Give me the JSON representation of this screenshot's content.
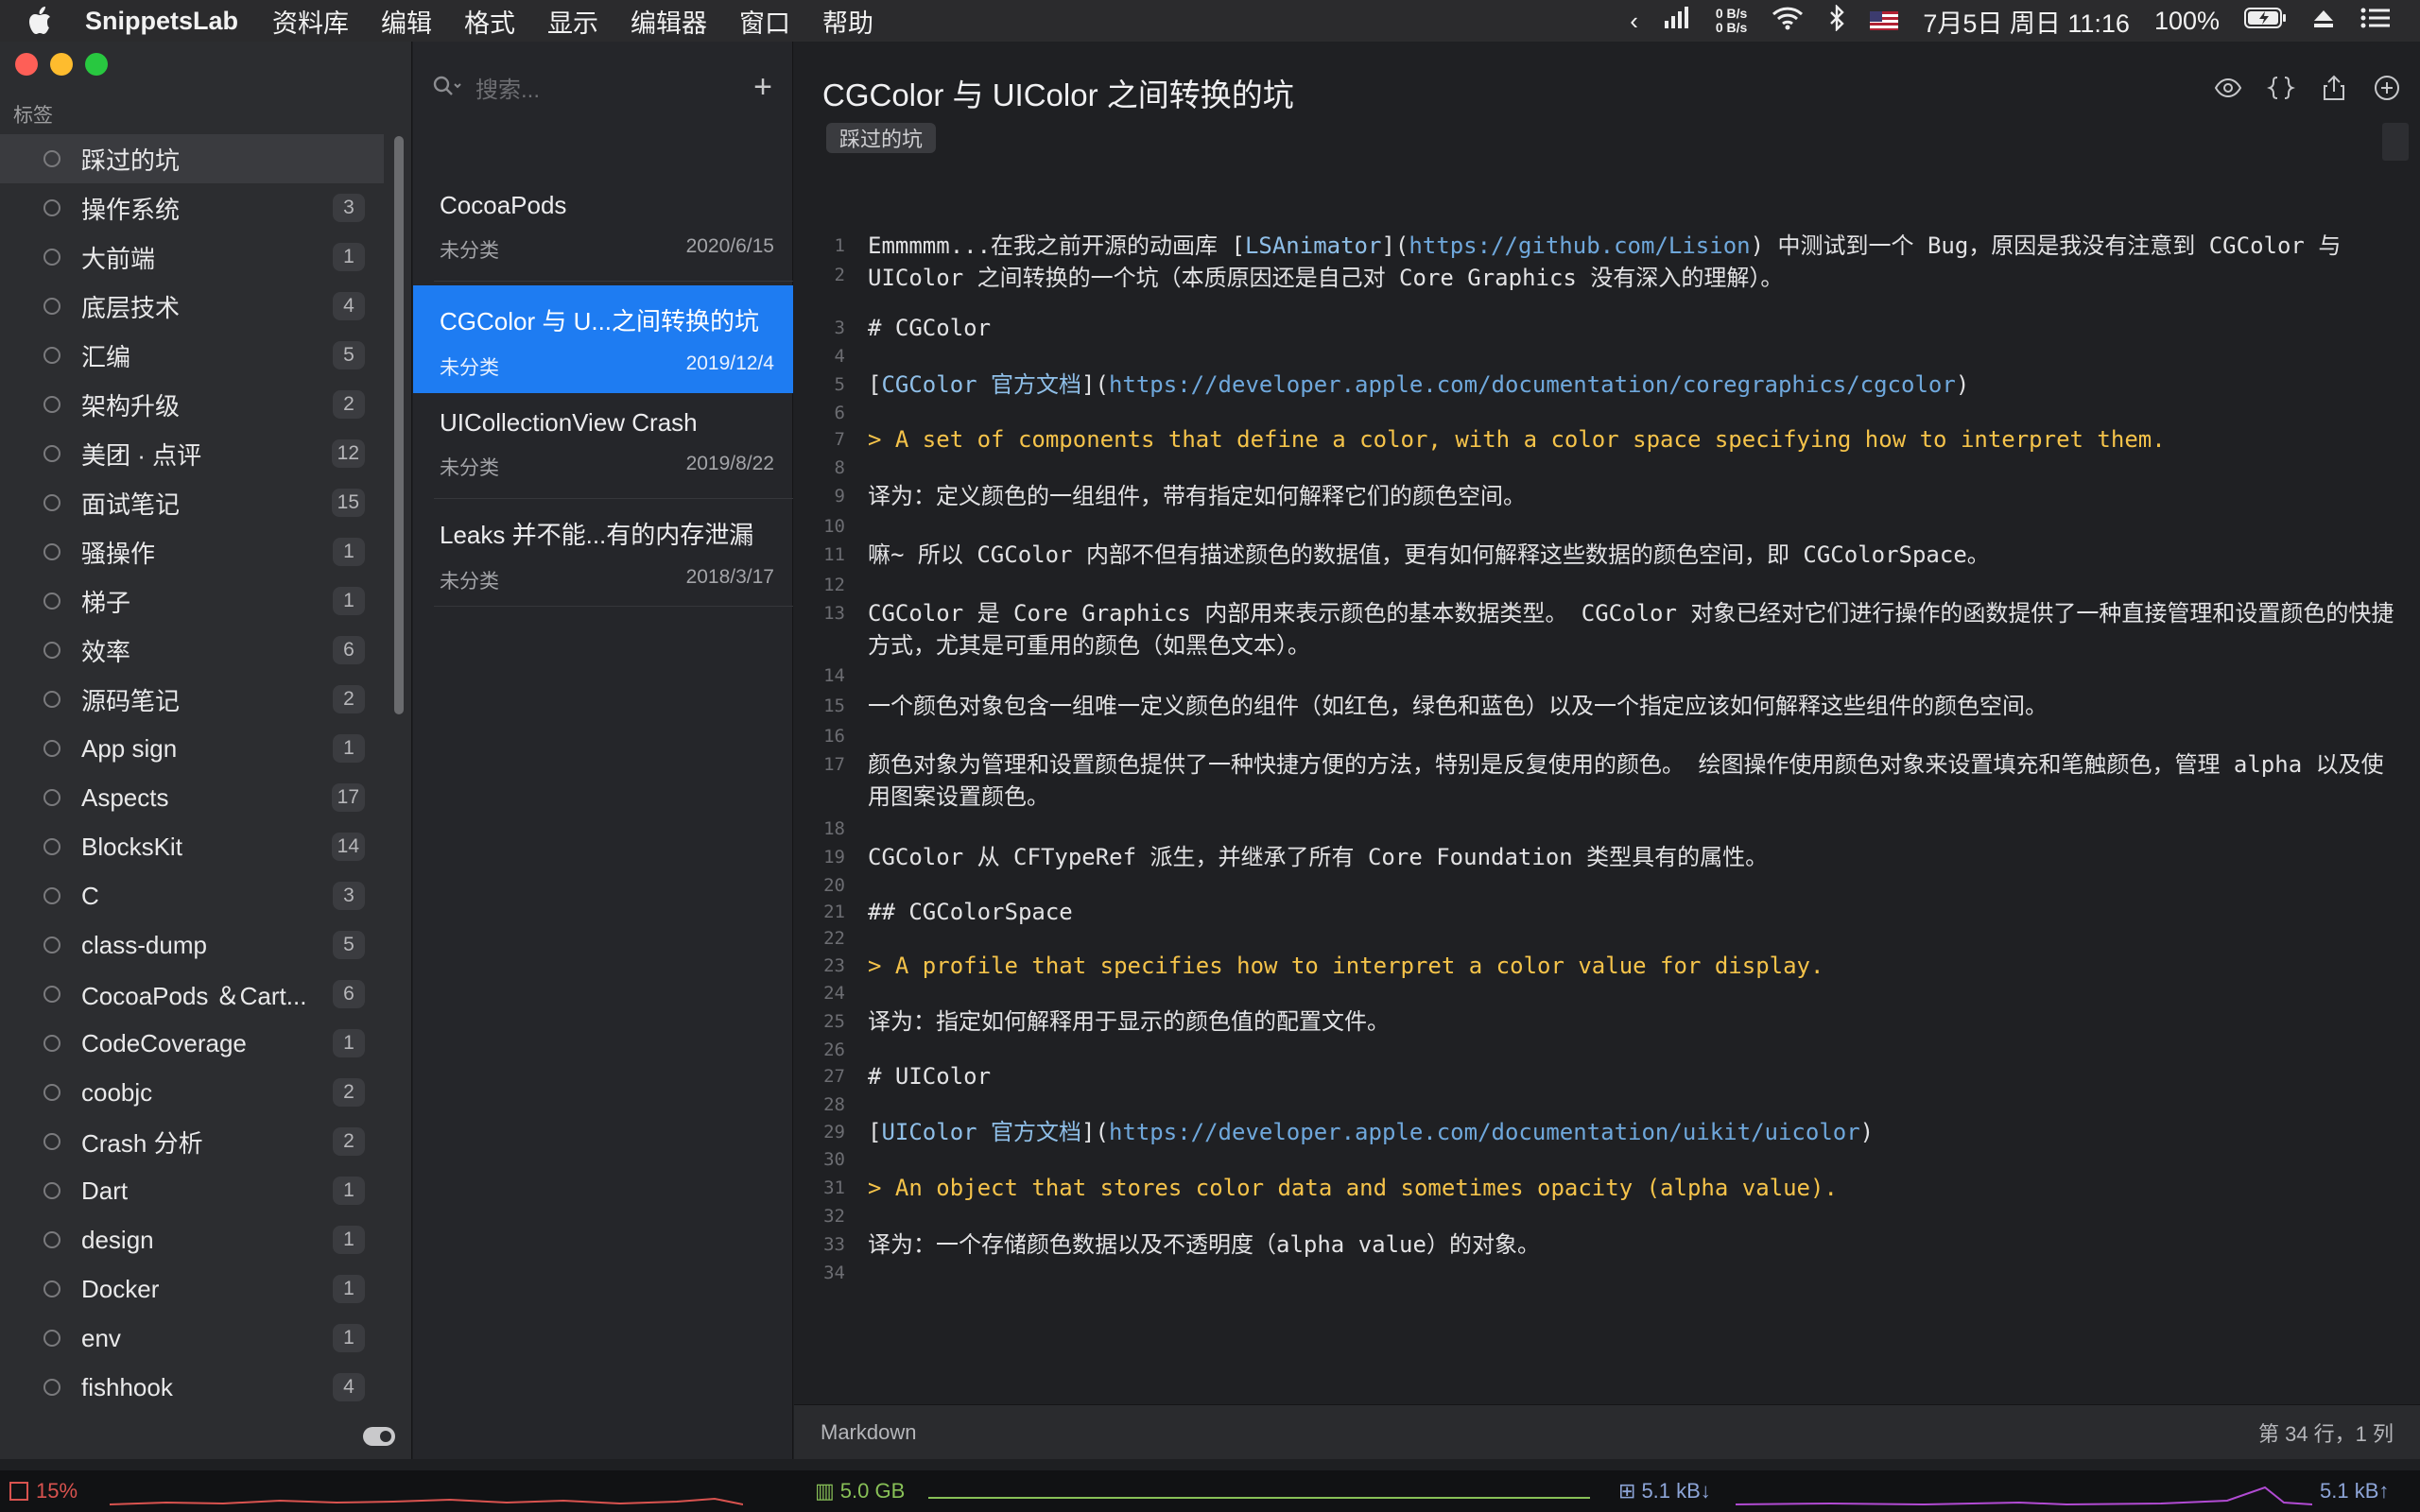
{
  "menubar": {
    "app_name": "SnippetsLab",
    "menus": [
      "资料库",
      "编辑",
      "格式",
      "显示",
      "编辑器",
      "窗口",
      "帮助"
    ],
    "net_up": "0 B/s",
    "net_down": "0 B/s",
    "datetime": "7月5日 周日 11:16",
    "battery": "100%"
  },
  "sidebar": {
    "header": "标签",
    "tags": [
      {
        "label": "踩过的坑",
        "count": ""
      },
      {
        "label": "操作系统",
        "count": "3"
      },
      {
        "label": "大前端",
        "count": "1"
      },
      {
        "label": "底层技术",
        "count": "4"
      },
      {
        "label": "汇编",
        "count": "5"
      },
      {
        "label": "架构升级",
        "count": "2"
      },
      {
        "label": "美团 · 点评",
        "count": "12"
      },
      {
        "label": "面试笔记",
        "count": "15"
      },
      {
        "label": "骚操作",
        "count": "1"
      },
      {
        "label": "梯子",
        "count": "1"
      },
      {
        "label": "效率",
        "count": "6"
      },
      {
        "label": "源码笔记",
        "count": "2"
      },
      {
        "label": "App sign",
        "count": "1"
      },
      {
        "label": "Aspects",
        "count": "17"
      },
      {
        "label": "BlocksKit",
        "count": "14"
      },
      {
        "label": "C",
        "count": "3"
      },
      {
        "label": "class-dump",
        "count": "5"
      },
      {
        "label": "CocoaPods ＆Cart...",
        "count": "6"
      },
      {
        "label": "CodeCoverage",
        "count": "1"
      },
      {
        "label": "coobjc",
        "count": "2"
      },
      {
        "label": "Crash 分析",
        "count": "2"
      },
      {
        "label": "Dart",
        "count": "1"
      },
      {
        "label": "design",
        "count": "1"
      },
      {
        "label": "Docker",
        "count": "1"
      },
      {
        "label": "env",
        "count": "1"
      },
      {
        "label": "fishhook",
        "count": "4"
      }
    ]
  },
  "list": {
    "search_placeholder": "搜索...",
    "snippets": [
      {
        "title": "CocoaPods",
        "folder": "未分类",
        "date": "2020/6/15"
      },
      {
        "title": "CGColor 与 U...之间转换的坑",
        "folder": "未分类",
        "date": "2019/12/4"
      },
      {
        "title": "UICollectionView Crash",
        "folder": "未分类",
        "date": "2019/8/22"
      },
      {
        "title": "Leaks 并不能...有的内存泄漏",
        "folder": "未分类",
        "date": "2018/3/17"
      }
    ]
  },
  "editor": {
    "title": "CGColor 与 UIColor 之间转换的坑",
    "tag": "踩过的坑",
    "language": "Markdown",
    "cursor": "第 34 行，1 列",
    "lines": {
      "l1a": "Emmmmm...在我之前开源的动画库 [",
      "l1b": "LSAnimator",
      "l1c": "](",
      "l1d": "https://github.com/Lision",
      "l1e": ") 中测试到一个 Bug，原因是我没有注意到 CGColor 与 UIColor 之间转换的一个坑（本质原因还是自己对 Core Graphics 没有深入的理解）。",
      "l3": "# CGColor",
      "l5a": "[",
      "l5b": "CGColor 官方文档",
      "l5c": "](",
      "l5d": "https://developer.apple.com/documentation/coregraphics/cgcolor",
      "l5e": ")",
      "l7": "> A set of components that define a color, with a color space specifying how to interpret them.",
      "l9": "译为：定义颜色的一组组件，带有指定如何解释它们的颜色空间。",
      "l11": "嘛~ 所以 CGColor 内部不但有描述颜色的数据值，更有如何解释这些数据的颜色空间，即 CGColorSpace。",
      "l13": "CGColor 是 Core Graphics 内部用来表示颜色的基本数据类型。 CGColor 对象已经对它们进行操作的函数提供了一种直接管理和设置颜色的快捷方式，尤其是可重用的颜色（如黑色文本）。",
      "l15": "一个颜色对象包含一组唯一定义颜色的组件（如红色，绿色和蓝色）以及一个指定应该如何解释这些组件的颜色空间。",
      "l17": "颜色对象为管理和设置颜色提供了一种快捷方便的方法，特别是反复使用的颜色。 绘图操作使用颜色对象来设置填充和笔触颜色，管理 alpha 以及使用图案设置颜色。",
      "l19": "CGColor 从 CFTypeRef 派生，并继承了所有 Core Foundation 类型具有的属性。",
      "l21": "## CGColorSpace",
      "l23": "> A profile that specifies how to interpret a color value for display.",
      "l25": "译为：指定如何解释用于显示的颜色值的配置文件。",
      "l27": "# UIColor",
      "l29a": "[",
      "l29b": "UIColor 官方文档",
      "l29c": "](",
      "l29d": "https://developer.apple.com/documentation/uikit/uicolor",
      "l29e": ")",
      "l31": "> An object that stores color data and sometimes opacity (alpha value).",
      "l33": "译为：一个存储颜色数据以及不透明度（alpha value）的对象。"
    },
    "line_numbers": [
      "1",
      "2",
      "3",
      "4",
      "5",
      "6",
      "7",
      "8",
      "9",
      "10",
      "11",
      "12",
      "13",
      "14",
      "15",
      "16",
      "17",
      "18",
      "19",
      "20",
      "21",
      "22",
      "23",
      "24",
      "25",
      "26",
      "27",
      "28",
      "29",
      "30",
      "31",
      "32",
      "33",
      "34"
    ]
  },
  "monitor": {
    "cpu": "15%",
    "memory": "5.0 GB",
    "net_down": "5.1 kB↓",
    "net_up": "5.1 kB↑"
  },
  "colors": {
    "accent": "#1e7cf2",
    "quote": "#f5c34a",
    "link": "#6fa8dc"
  }
}
